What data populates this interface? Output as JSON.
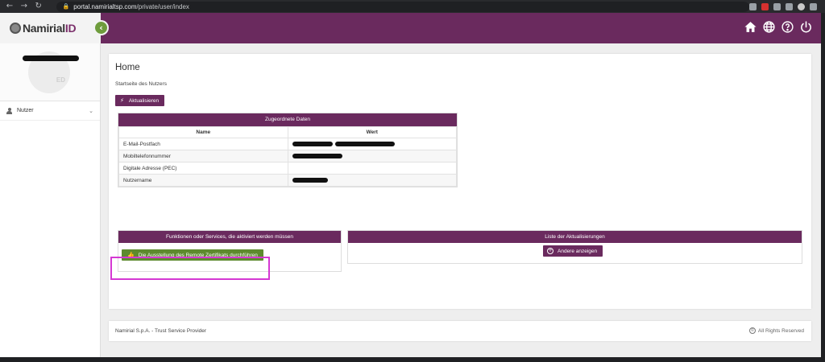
{
  "browser": {
    "url_host": "portal.namirialtsp.com",
    "url_path": "/private/user/index"
  },
  "header": {
    "logo_text": "Namirial",
    "logo_suffix": "ID",
    "collapse_icon": "chevron-left-icon",
    "icons": [
      "home-icon",
      "globe-icon",
      "help-icon",
      "power-icon"
    ]
  },
  "sidebar": {
    "avatar_suffix": "ED",
    "items": [
      {
        "label": "Nutzer",
        "icon": "user-icon"
      }
    ]
  },
  "main": {
    "title": "Home",
    "subtitle": "Startseite des Nutzers",
    "refresh_label": "Aktualisieren",
    "table": {
      "title": "Zugeordnete Daten",
      "columns": [
        "Name",
        "Wert"
      ],
      "rows": [
        {
          "name": "E-Mail-Postfach"
        },
        {
          "name": "Mobiltelefonnummer"
        },
        {
          "name": "Digitale Adresse (PEC)"
        },
        {
          "name": "Nutzername"
        }
      ]
    },
    "functions_panel": {
      "title": "Funktionen oder Services, die aktiviert werden müssen",
      "button_label": "Die Ausstellung des Remote Zertifikats durchführen"
    },
    "updates_panel": {
      "title": "Liste der Aktualisierungen",
      "button_label": "Andere anzeigen"
    }
  },
  "footer": {
    "company": "Namirial S.p.A. - Trust Service Provider",
    "rights": "All Rights Reserved"
  },
  "colors": {
    "brand": "#6a2a5e",
    "accent_green": "#5d8a2e",
    "highlight": "#d538d3"
  }
}
